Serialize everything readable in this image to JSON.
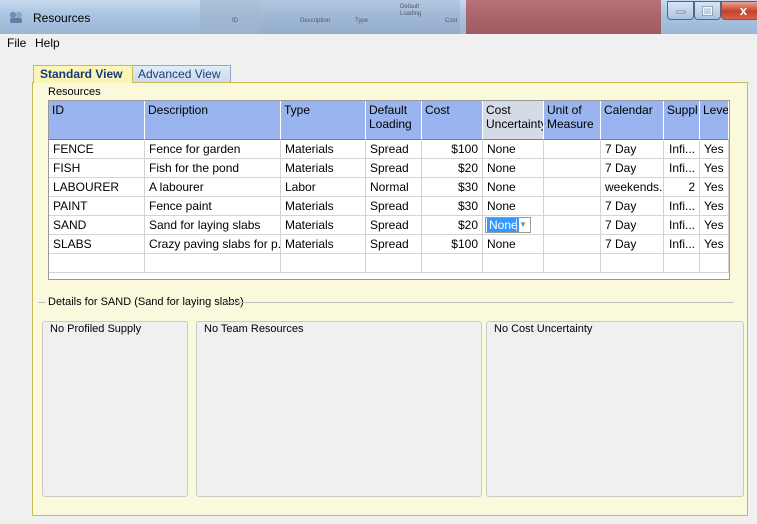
{
  "window": {
    "title": "Resources",
    "close_glyph": "x",
    "background_text": [
      "ID",
      "Description",
      "Type",
      "Default Loading",
      "Cost"
    ]
  },
  "menu": {
    "items": [
      "File",
      "Help"
    ]
  },
  "tabs": [
    {
      "label": "Standard View",
      "active": true
    },
    {
      "label": "Advanced View",
      "active": false
    }
  ],
  "resources_group": {
    "label": "Resources",
    "columns": [
      "ID",
      "Description",
      "Type",
      "Default Loading",
      "Cost",
      "Cost Uncertainty",
      "Unit of Measure",
      "Calendar",
      "Suppl",
      "Leve"
    ],
    "rows": [
      [
        "FENCE",
        "Fence for garden",
        "Materials",
        "Spread",
        "$100",
        "None",
        "",
        "7 Day",
        "Infi...",
        "Yes"
      ],
      [
        "FISH",
        "Fish for the pond",
        "Materials",
        "Spread",
        "$20",
        "None",
        "",
        "7 Day",
        "Infi...",
        "Yes"
      ],
      [
        "LABOURER",
        "A labourer",
        "Labor",
        "Normal",
        "$30",
        "None",
        "",
        "weekends...",
        "2",
        "Yes"
      ],
      [
        "PAINT",
        "Fence paint",
        "Materials",
        "Spread",
        "$30",
        "None",
        "",
        "7 Day",
        "Infi...",
        "Yes"
      ],
      [
        "SAND",
        "Sand for laying slabs",
        "Materials",
        "Spread",
        "$20",
        "None",
        "",
        "7 Day",
        "Infi...",
        "Yes"
      ],
      [
        "SLABS",
        "Crazy paving slabs for p...",
        "Materials",
        "Spread",
        "$100",
        "None",
        "",
        "7 Day",
        "Infi...",
        "Yes"
      ]
    ],
    "editing_row": 4,
    "editing_col": 5
  },
  "details": {
    "label": "Details for SAND (Sand for laying slabs)",
    "panes": [
      "No Profiled Supply",
      "No Team Resources",
      "No Cost Uncertainty"
    ]
  },
  "colors": {
    "header_bg": "#99b4ee",
    "tab_active_bg": "#fbf6b6",
    "selection": "#3399ff"
  }
}
